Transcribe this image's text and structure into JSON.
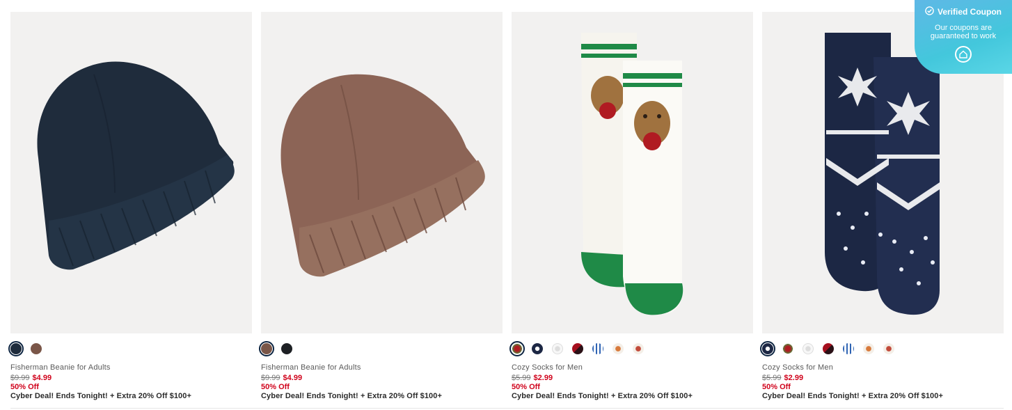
{
  "products": [
    {
      "name": "Fisherman Beanie for Adults",
      "old_price": "$9.99",
      "new_price": "$4.99",
      "discount": "50% Off",
      "deal": "Cyber Deal! Ends Tonight! + Extra 20% Off $100+",
      "image": "navy-beanie",
      "swatches": [
        "#1d2b3c",
        "#7a5648"
      ],
      "selected_swatch": 0
    },
    {
      "name": "Fisherman Beanie for Adults",
      "old_price": "$9.99",
      "new_price": "$4.99",
      "discount": "50% Off",
      "deal": "Cyber Deal! Ends Tonight! + Extra 20% Off $100+",
      "image": "brown-beanie",
      "swatches": [
        "#7a5648",
        "#1d2024"
      ],
      "selected_swatch": 0
    },
    {
      "name": "Cozy Socks for Men",
      "old_price": "$5.99",
      "new_price": "$2.99",
      "discount": "50% Off",
      "deal": "Cyber Deal! Ends Tonight! + Extra 20% Off $100+",
      "image": "dog-socks",
      "swatches": [
        "dog",
        "snowflake",
        "polar-bear",
        "red-plaid",
        "blue-pattern",
        "fox",
        "fox-red"
      ],
      "selected_swatch": 0
    },
    {
      "name": "Cozy Socks for Men",
      "old_price": "$5.99",
      "new_price": "$2.99",
      "discount": "50% Off",
      "deal": "Cyber Deal! Ends Tonight! + Extra 20% Off $100+",
      "image": "fairisle-socks",
      "swatches": [
        "snowflake",
        "dog",
        "polar-bear",
        "red-plaid",
        "blue-pattern",
        "fox",
        "fox-red"
      ],
      "selected_swatch": 0
    }
  ],
  "coupon": {
    "title": "Verified Coupon",
    "line1": "Our coupons are",
    "line2": "guaranteed to work"
  }
}
